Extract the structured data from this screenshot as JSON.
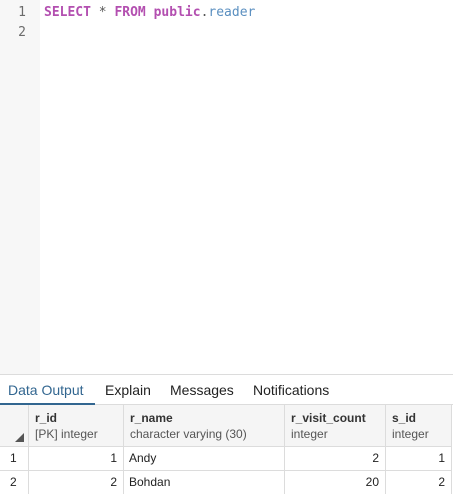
{
  "editor": {
    "line_numbers": [
      "1",
      "2"
    ],
    "query": {
      "select_kw": "SELECT",
      "star": "*",
      "from_kw": "FROM",
      "schema": "public",
      "dot": ".",
      "table": "reader"
    }
  },
  "tabs": [
    {
      "label": "Data Output",
      "active": true
    },
    {
      "label": "Explain",
      "active": false
    },
    {
      "label": "Messages",
      "active": false
    },
    {
      "label": "Notifications",
      "active": false
    }
  ],
  "grid": {
    "columns": [
      {
        "name": "r_id",
        "type": "[PK] integer"
      },
      {
        "name": "r_name",
        "type": "character varying (30)"
      },
      {
        "name": "r_visit_count",
        "type": "integer"
      },
      {
        "name": "s_id",
        "type": "integer"
      }
    ],
    "rows": [
      {
        "num": "1",
        "cells": [
          "1",
          "Andy",
          "2",
          "1"
        ]
      },
      {
        "num": "2",
        "cells": [
          "2",
          "Bohdan",
          "20",
          "2"
        ]
      }
    ]
  },
  "colors": {
    "keyword": "#b34fb0",
    "table_name": "#5a8fc0",
    "active_tab": "#326690"
  }
}
